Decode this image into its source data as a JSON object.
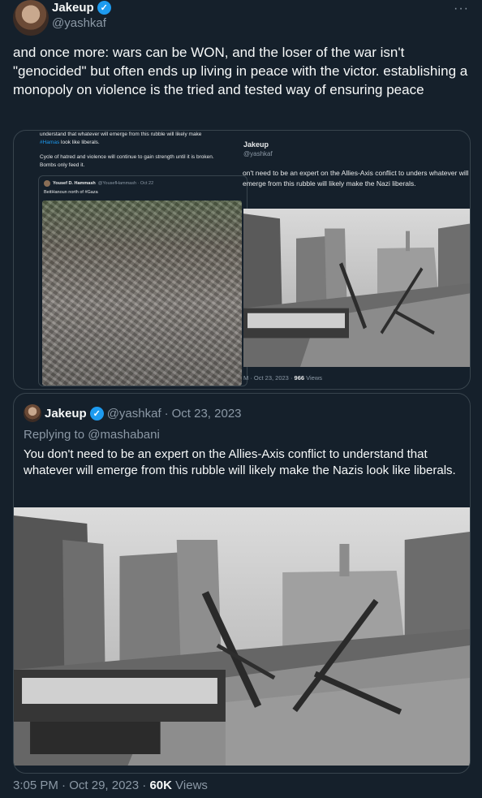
{
  "author": {
    "display_name": "Jakeup",
    "handle": "@yashkaf"
  },
  "tweet": {
    "text": "and once more: wars can be WON, and the loser of the war isn't \"genocided\" but often ends up living in peace with the victor. establishing a monopoly on violence is the tried and tested way of ensuring peace",
    "time": "3:05 PM",
    "date": "Oct 29, 2023",
    "views_count": "60K",
    "views_label": "Views"
  },
  "media_left": {
    "line1": "understand that whatever will emerge from this rubble will likely make",
    "line2_hashtag": "#Hamas",
    "line2_rest": " look like liberals.",
    "line3": "Cycle of hatred and violence will continue to gain strength until it is broken.",
    "line4": "Bombs only feed it.",
    "inner_name": "Yousef D. Hammash",
    "inner_handle": "@YousefHammash · Oct 22",
    "inner_text": "BeitHanoun north of #Gaza"
  },
  "media_right": {
    "name": "Jakeup",
    "handle": "@yashkaf",
    "text": "on't need to be an expert on the Allies-Axis conflict to unders whatever will emerge from this rubble will likely make the Nazi liberals.",
    "meta": "M · Oct 23, 2023 · ",
    "views_count": "966",
    "views_label": " Views"
  },
  "quote": {
    "display_name": "Jakeup",
    "handle": "@yashkaf",
    "separator": "·",
    "date": "Oct 23, 2023",
    "replying_to": "Replying to @mashabani",
    "text": "You don't need to be an expert on the Allies-Axis conflict to understand that whatever will emerge from this rubble will likely make the Nazis look like liberals."
  },
  "icons": {
    "verified": "verified-badge-icon",
    "more": "more-options-icon"
  },
  "colors": {
    "background": "#15202b",
    "text": "#f7f9f9",
    "muted": "#8b98a5",
    "border": "#38444d",
    "accent": "#1d9bf0"
  }
}
